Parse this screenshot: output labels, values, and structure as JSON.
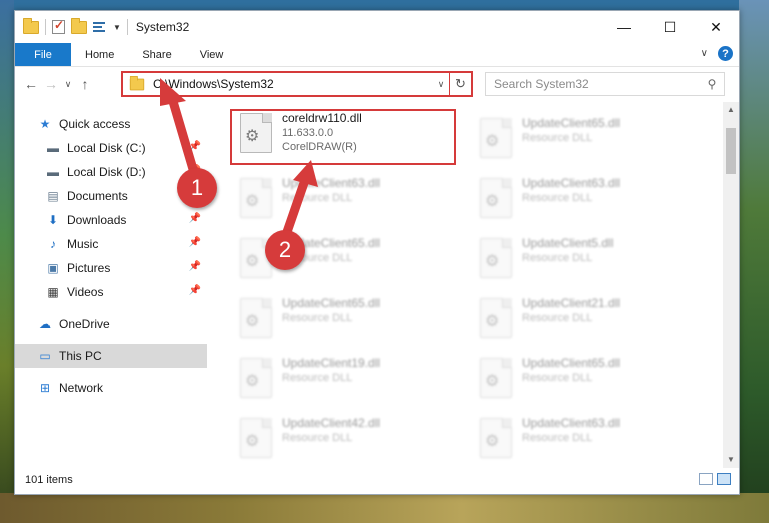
{
  "window": {
    "title": "System32"
  },
  "ribbon": {
    "tabs": [
      "File",
      "Home",
      "Share",
      "View"
    ]
  },
  "address": {
    "path": "C:\\Windows\\System32"
  },
  "search": {
    "placeholder": "Search System32"
  },
  "sidebar": {
    "items": [
      {
        "label": "Quick access",
        "icon": "star-icon"
      },
      {
        "label": "Local Disk (C:)",
        "icon": "drive-icon",
        "pinned": true
      },
      {
        "label": "Local Disk (D:)",
        "icon": "drive-icon",
        "pinned": true
      },
      {
        "label": "Documents",
        "icon": "documents-icon",
        "pinned": true
      },
      {
        "label": "Downloads",
        "icon": "download-icon",
        "pinned": true
      },
      {
        "label": "Music",
        "icon": "music-icon",
        "pinned": true
      },
      {
        "label": "Pictures",
        "icon": "pictures-icon",
        "pinned": true
      },
      {
        "label": "Videos",
        "icon": "videos-icon",
        "pinned": true
      },
      {
        "label": "OneDrive",
        "icon": "cloud-icon"
      },
      {
        "label": "This PC",
        "icon": "computer-icon",
        "selected": true
      },
      {
        "label": "Network",
        "icon": "network-icon"
      }
    ]
  },
  "files": {
    "highlighted": {
      "name": "coreldrw110.dll",
      "version": "11.633.0.0",
      "company": "CorelDRAW(R)"
    },
    "items": [
      {
        "name": "UpdateClient65.dll",
        "type": "Resource DLL"
      },
      {
        "name": "UpdateClient63.dll",
        "type": "Resource DLL"
      },
      {
        "name": "UpdateClient63.dll",
        "type": "Resource DLL"
      },
      {
        "name": "UpdateClient65.dll",
        "type": "Resource DLL"
      },
      {
        "name": "UpdateClient5.dll",
        "type": "Resource DLL"
      },
      {
        "name": "UpdateClient65.dll",
        "type": "Resource DLL"
      },
      {
        "name": "UpdateClient21.dll",
        "type": "Resource DLL"
      },
      {
        "name": "UpdateClient19.dll",
        "type": "Resource DLL"
      },
      {
        "name": "UpdateClient65.dll",
        "type": "Resource DLL"
      },
      {
        "name": "UpdateClient42.dll",
        "type": "Resource DLL"
      },
      {
        "name": "UpdateClient63.dll",
        "type": "Resource DLL"
      }
    ]
  },
  "status": {
    "item_count": "101 items"
  },
  "annotations": {
    "step1": "1",
    "step2": "2"
  },
  "colors": {
    "accent": "#1979ca",
    "annotation_red": "#d53a3a"
  }
}
